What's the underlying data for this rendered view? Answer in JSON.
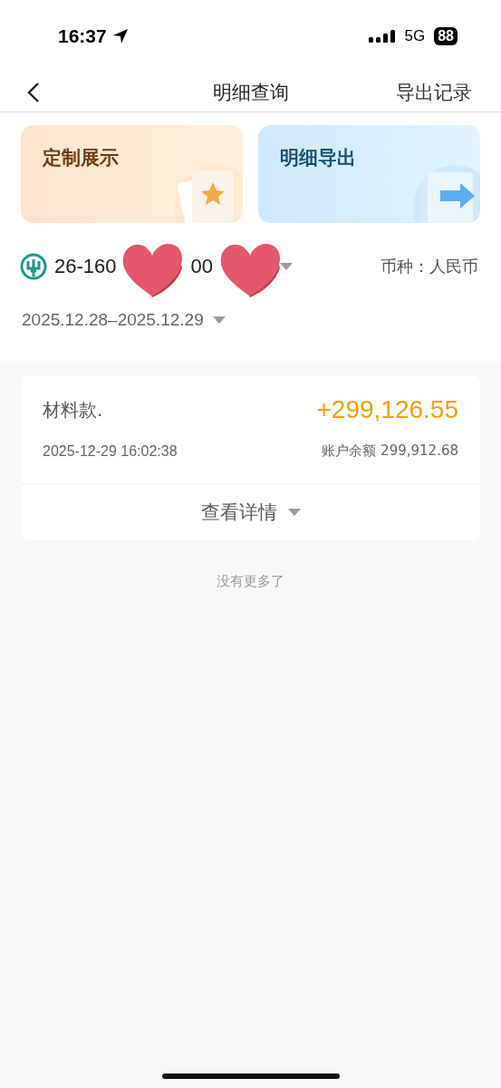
{
  "status_bar": {
    "time": "16:37",
    "network": "5G",
    "battery": "88"
  },
  "nav": {
    "title": "明细查询",
    "action": "导出记录"
  },
  "shortcuts": [
    {
      "kind": "custom",
      "label": "定制展示"
    },
    {
      "kind": "export",
      "label": "明细导出"
    }
  ],
  "account": {
    "number_start": "26-160",
    "number_end": "00",
    "currency": "币种：人民币"
  },
  "date_range": "2025.12.28–2025.12.29",
  "transactions": [
    {
      "title": "材料款.",
      "amount": "+299,126.55",
      "time": "2025-12-29 16:02:38",
      "balance": "账户余额 299,912.68",
      "details": "查看详情"
    }
  ],
  "footer": "没有更多了"
}
